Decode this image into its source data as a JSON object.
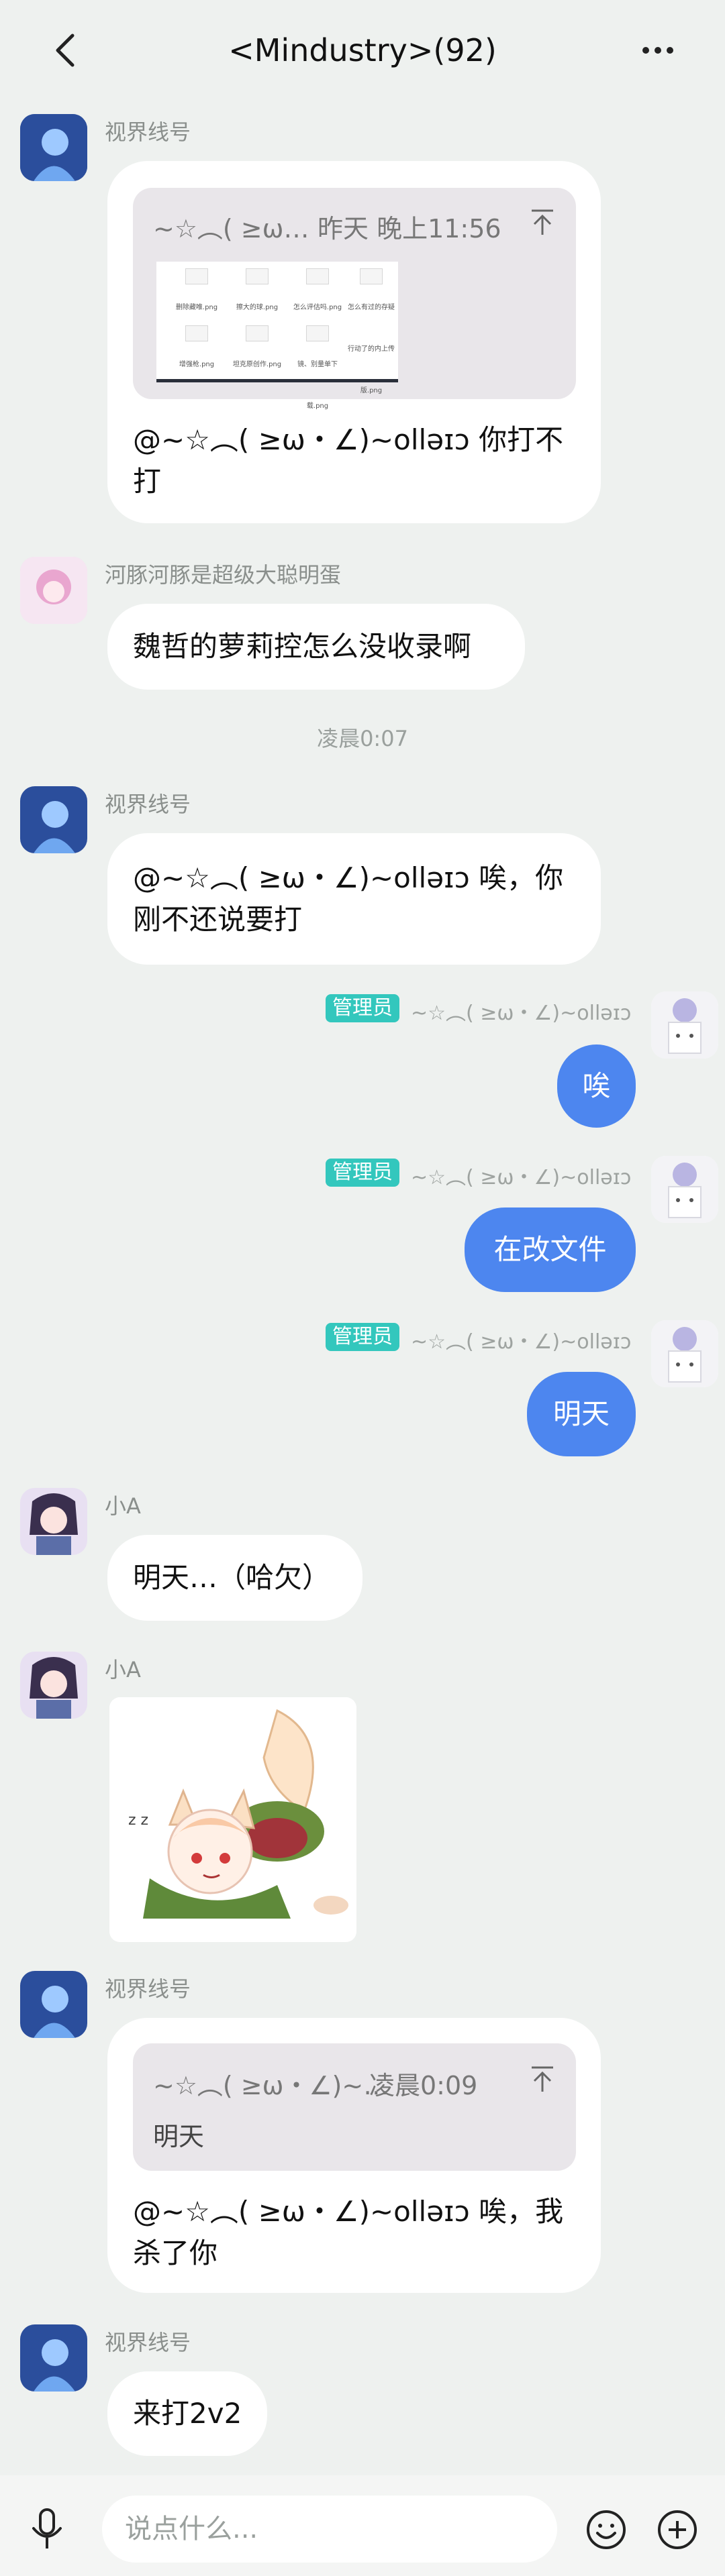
{
  "header": {
    "title": "<Mindustry>(92)",
    "back_icon": "chevron-left-icon",
    "more_icon": "more-dots-icon"
  },
  "colors": {
    "background": "#eef1ef",
    "my_bubble": "#4d86ef",
    "admin_badge": "#33c7bd"
  },
  "messages": {
    "m1": {
      "sender": "视界线号",
      "quote": {
        "author": "~☆︵( ≥ω…",
        "time": "昨天 晚上11:56",
        "files": [
          "删除藏唯.png",
          "擦大的球.png",
          "怎么评估吗.png",
          "怎么有过的存疑行动了的内上传版.png",
          "增强枪.png",
          "坦克原创作.png",
          "镜、别量单下载.png"
        ]
      },
      "text": "@~☆︵( ≥ω・∠)~ollǝɪɔ 你打不打"
    },
    "m2": {
      "sender": "河豚河豚是超级大聪明蛋",
      "text": "魏哲的萝莉控怎么没收录啊"
    },
    "time1": "凌晨0:07",
    "m3": {
      "sender": "视界线号",
      "text": "@~☆︵( ≥ω・∠)~ollǝɪɔ 唉，你刚不还说要打"
    },
    "me": {
      "badge": "管理员",
      "name": "~☆︵( ≥ω・∠)~ollǝɪɔ"
    },
    "m4": {
      "text": "唉"
    },
    "m5": {
      "text": "在改文件"
    },
    "m6": {
      "text": "明天"
    },
    "m7": {
      "sender": "小A",
      "text": "明天…（哈欠）"
    },
    "m8": {
      "sender": "小A",
      "sticker": "sticker-fox-girl-crawling"
    },
    "m9": {
      "sender": "视界线号",
      "quote": {
        "author": "~☆︵( ≥ω・∠)~…",
        "time": "凌晨0:09",
        "body": "明天"
      },
      "text": "@~☆︵( ≥ω・∠)~ollǝɪɔ 唉，我杀了你"
    },
    "m10": {
      "sender": "视界线号",
      "text": "来打2v2"
    }
  },
  "input": {
    "placeholder": "说点什么...",
    "value": ""
  }
}
